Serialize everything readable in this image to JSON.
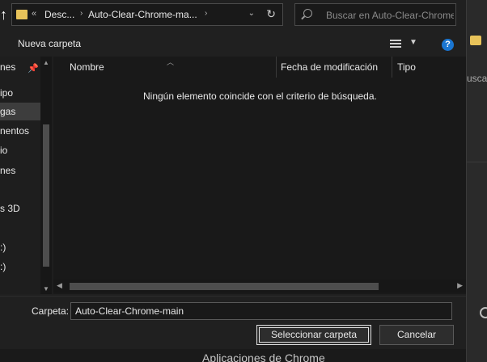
{
  "address_bar": {
    "overflow_glyph": "«",
    "crumbs": [
      "Desc...",
      "Auto-Clear-Chrome-ma..."
    ]
  },
  "search": {
    "placeholder": "Buscar en Auto-Clear-Chrome-main"
  },
  "toolbar": {
    "new_folder_label": "Nueva carpeta",
    "help_glyph": "?"
  },
  "nav_pane": {
    "items": [
      "nes",
      "ipo",
      "gas",
      "nentos",
      "io",
      "nes",
      "s 3D",
      ":)",
      ":)"
    ],
    "selected_index": 2
  },
  "file_list": {
    "columns": [
      "Nombre",
      "Fecha de modificación",
      "Tipo"
    ],
    "empty_message": "Ningún elemento coincide con el criterio de búsqueda."
  },
  "footer": {
    "folder_label": "Carpeta:",
    "folder_value": "Auto-Clear-Chrome-main",
    "select_button": "Seleccionar carpeta",
    "cancel_button": "Cancelar"
  },
  "background_app": {
    "side_text": "uscar",
    "bottom_text": "Aplicaciones de Chrome"
  },
  "colors": {
    "accent_folder": "#e8c35a",
    "help_blue": "#1a76d2",
    "dark_bg": "#202020"
  }
}
